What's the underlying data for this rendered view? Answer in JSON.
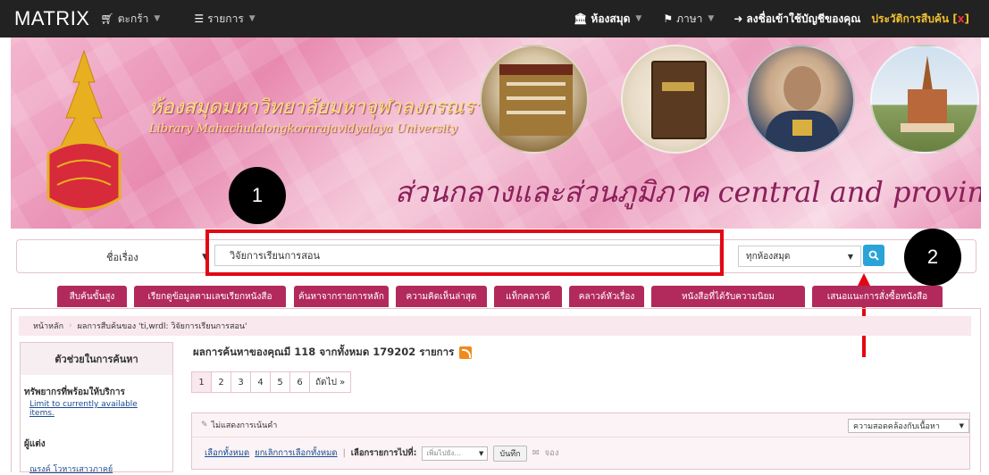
{
  "topnav": {
    "brand": "MATRIX",
    "cart_label": "ตะกร้า",
    "menu_label": "รายการ",
    "library_label": "ห้องสมุด",
    "language_label": "ภาษา",
    "login_label": "ลงชื่อเข้าใช้บัญชีของคุณ",
    "history_label": "ประวัติการสืบค้น",
    "history_close": "x"
  },
  "banner": {
    "university_th": "ห้องสมุดมหาวิทยาลัยมหาจุฬาลงกรณราชวิทยาลัย",
    "university_en": "Library Mahachulalongkornrajavidyalaya University",
    "tagline": "ส่วนกลางและส่วนภูมิภาค central and provincial"
  },
  "search": {
    "field_selected": "ชื่อเรื่อง",
    "query": "วิจัยการเรียนการสอน",
    "library_selected": "ทุกห้องสมุด"
  },
  "annotations": {
    "badge1": "1",
    "badge2": "2",
    "highlight_color": "#e30613"
  },
  "tabs": [
    {
      "label": "สืบค้นขั้นสูง"
    },
    {
      "label": "เรียกดูข้อมูลตามเลขเรียกหนังสือ"
    },
    {
      "label": "ค้นหาจากรายการหลัก"
    },
    {
      "label": "ความคิดเห็นล่าสุด"
    },
    {
      "label": "แท็กคลาวด์"
    },
    {
      "label": "คลาวด์หัวเรื่อง"
    },
    {
      "label": "หนังสือที่ได้รับความนิยม"
    },
    {
      "label": "เสนอแนะการสั่งซื้อหนังสือ"
    }
  ],
  "breadcrumb": {
    "home": "หน้าหลัก",
    "current": "ผลการสืบค้นของ 'ti,wrdl: วิจัยการเรียนการสอน'"
  },
  "sidebar": {
    "title": "ตัวช่วยในการค้นหา",
    "availability_title": "ทรัพยากรที่พร้อมให้บริการ",
    "availability_link": "Limit to currently available items.",
    "author_title": "ผู้แต่ง",
    "author_first": "ณรงค์ โวหารเสาวภาคย์"
  },
  "results": {
    "summary": "ผลการค้นหาของคุณมี 118 จากทั้งหมด 179202 รายการ",
    "pages": [
      "1",
      "2",
      "3",
      "4",
      "5",
      "6"
    ],
    "next_label": "ถัดไป »",
    "highlight_toggle": "ไม่แสดงการเน้นคำ",
    "sort_selected": "ความสอดคล้องกับเนื้อหา",
    "select_all": "เลือกทั้งหมด",
    "clear_all": "ยกเลิกการเลือกทั้งหมด",
    "selected_to_label": "เลือกรายการไปที่:",
    "add_to_selected": "เพิ่มไปยัง...",
    "save_label": "บันทึก",
    "hold_label": "จอง"
  },
  "colors": {
    "nav_bg": "#222222",
    "tab_bg": "#b22a5c",
    "search_button": "#2aa3d8",
    "history_text": "#f0c030"
  }
}
